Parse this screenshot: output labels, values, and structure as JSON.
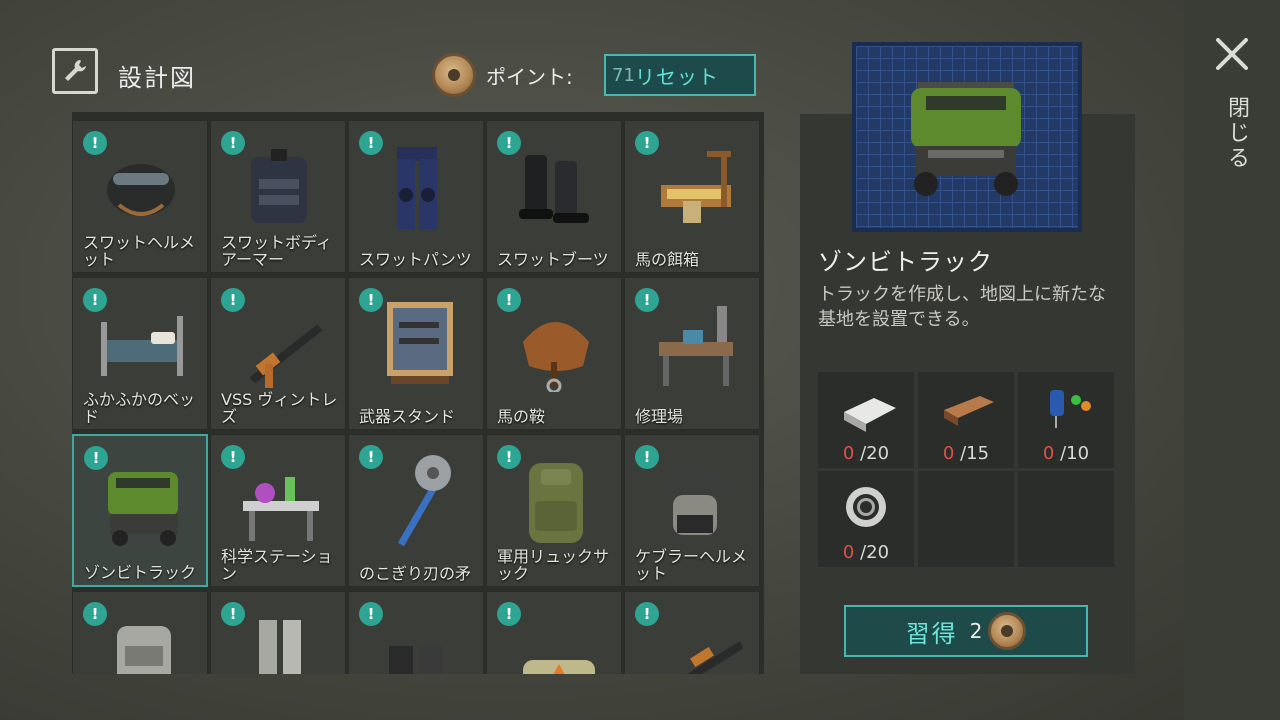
{
  "header": {
    "title": "設計図",
    "points_label": "ポイント:",
    "points_value": "71",
    "reset_label": "リセット"
  },
  "grid": {
    "items": [
      {
        "label": "スワットヘルメット",
        "icon": "swat-helmet-icon"
      },
      {
        "label": "スワットボディアーマー",
        "icon": "swat-body-armor-icon"
      },
      {
        "label": "スワットパンツ",
        "icon": "swat-pants-icon"
      },
      {
        "label": "スワットブーツ",
        "icon": "swat-boots-icon"
      },
      {
        "label": "馬の餌箱",
        "icon": "horse-feeder-icon"
      },
      {
        "label": "ふかふかのベッド",
        "icon": "bed-icon"
      },
      {
        "label": "VSS ヴィントレズ",
        "icon": "rifle-icon"
      },
      {
        "label": "武器スタンド",
        "icon": "weapon-stand-icon"
      },
      {
        "label": "馬の鞍",
        "icon": "saddle-icon"
      },
      {
        "label": "修理場",
        "icon": "workbench-icon"
      },
      {
        "label": "ゾンビトラック",
        "icon": "truck-icon"
      },
      {
        "label": "科学ステーション",
        "icon": "science-station-icon"
      },
      {
        "label": "のこぎり刃の矛",
        "icon": "saw-spear-icon"
      },
      {
        "label": "軍用リュックサック",
        "icon": "backpack-icon"
      },
      {
        "label": "ケブラーヘルメット",
        "icon": "kevlar-helmet-icon"
      },
      {
        "label": "",
        "icon": "armor-vest-icon"
      },
      {
        "label": "",
        "icon": "leg-armor-icon"
      },
      {
        "label": "",
        "icon": "boots-icon"
      },
      {
        "label": "",
        "icon": "explosive-icon"
      },
      {
        "label": "",
        "icon": "shotgun-icon"
      }
    ],
    "badge_glyph": "!"
  },
  "selected": {
    "name": "ゾンビトラック",
    "description": "トラックを作成し、地図上に新たな基地を設置できる。",
    "requirements": [
      {
        "icon": "aluminum-ingot-icon",
        "have": "0",
        "need": "/20"
      },
      {
        "icon": "wood-plank-icon",
        "have": "0",
        "need": "/15"
      },
      {
        "icon": "electronic-parts-icon",
        "have": "0",
        "need": "/10"
      },
      {
        "icon": "bearing-icon",
        "have": "0",
        "need": "/20"
      }
    ],
    "learn_label": "習得",
    "learn_cost": "2"
  },
  "close": {
    "label": "閉じる"
  },
  "colors": {
    "accent": "#47b6ad",
    "badge": "#2ea493",
    "missing": "#e05048"
  }
}
